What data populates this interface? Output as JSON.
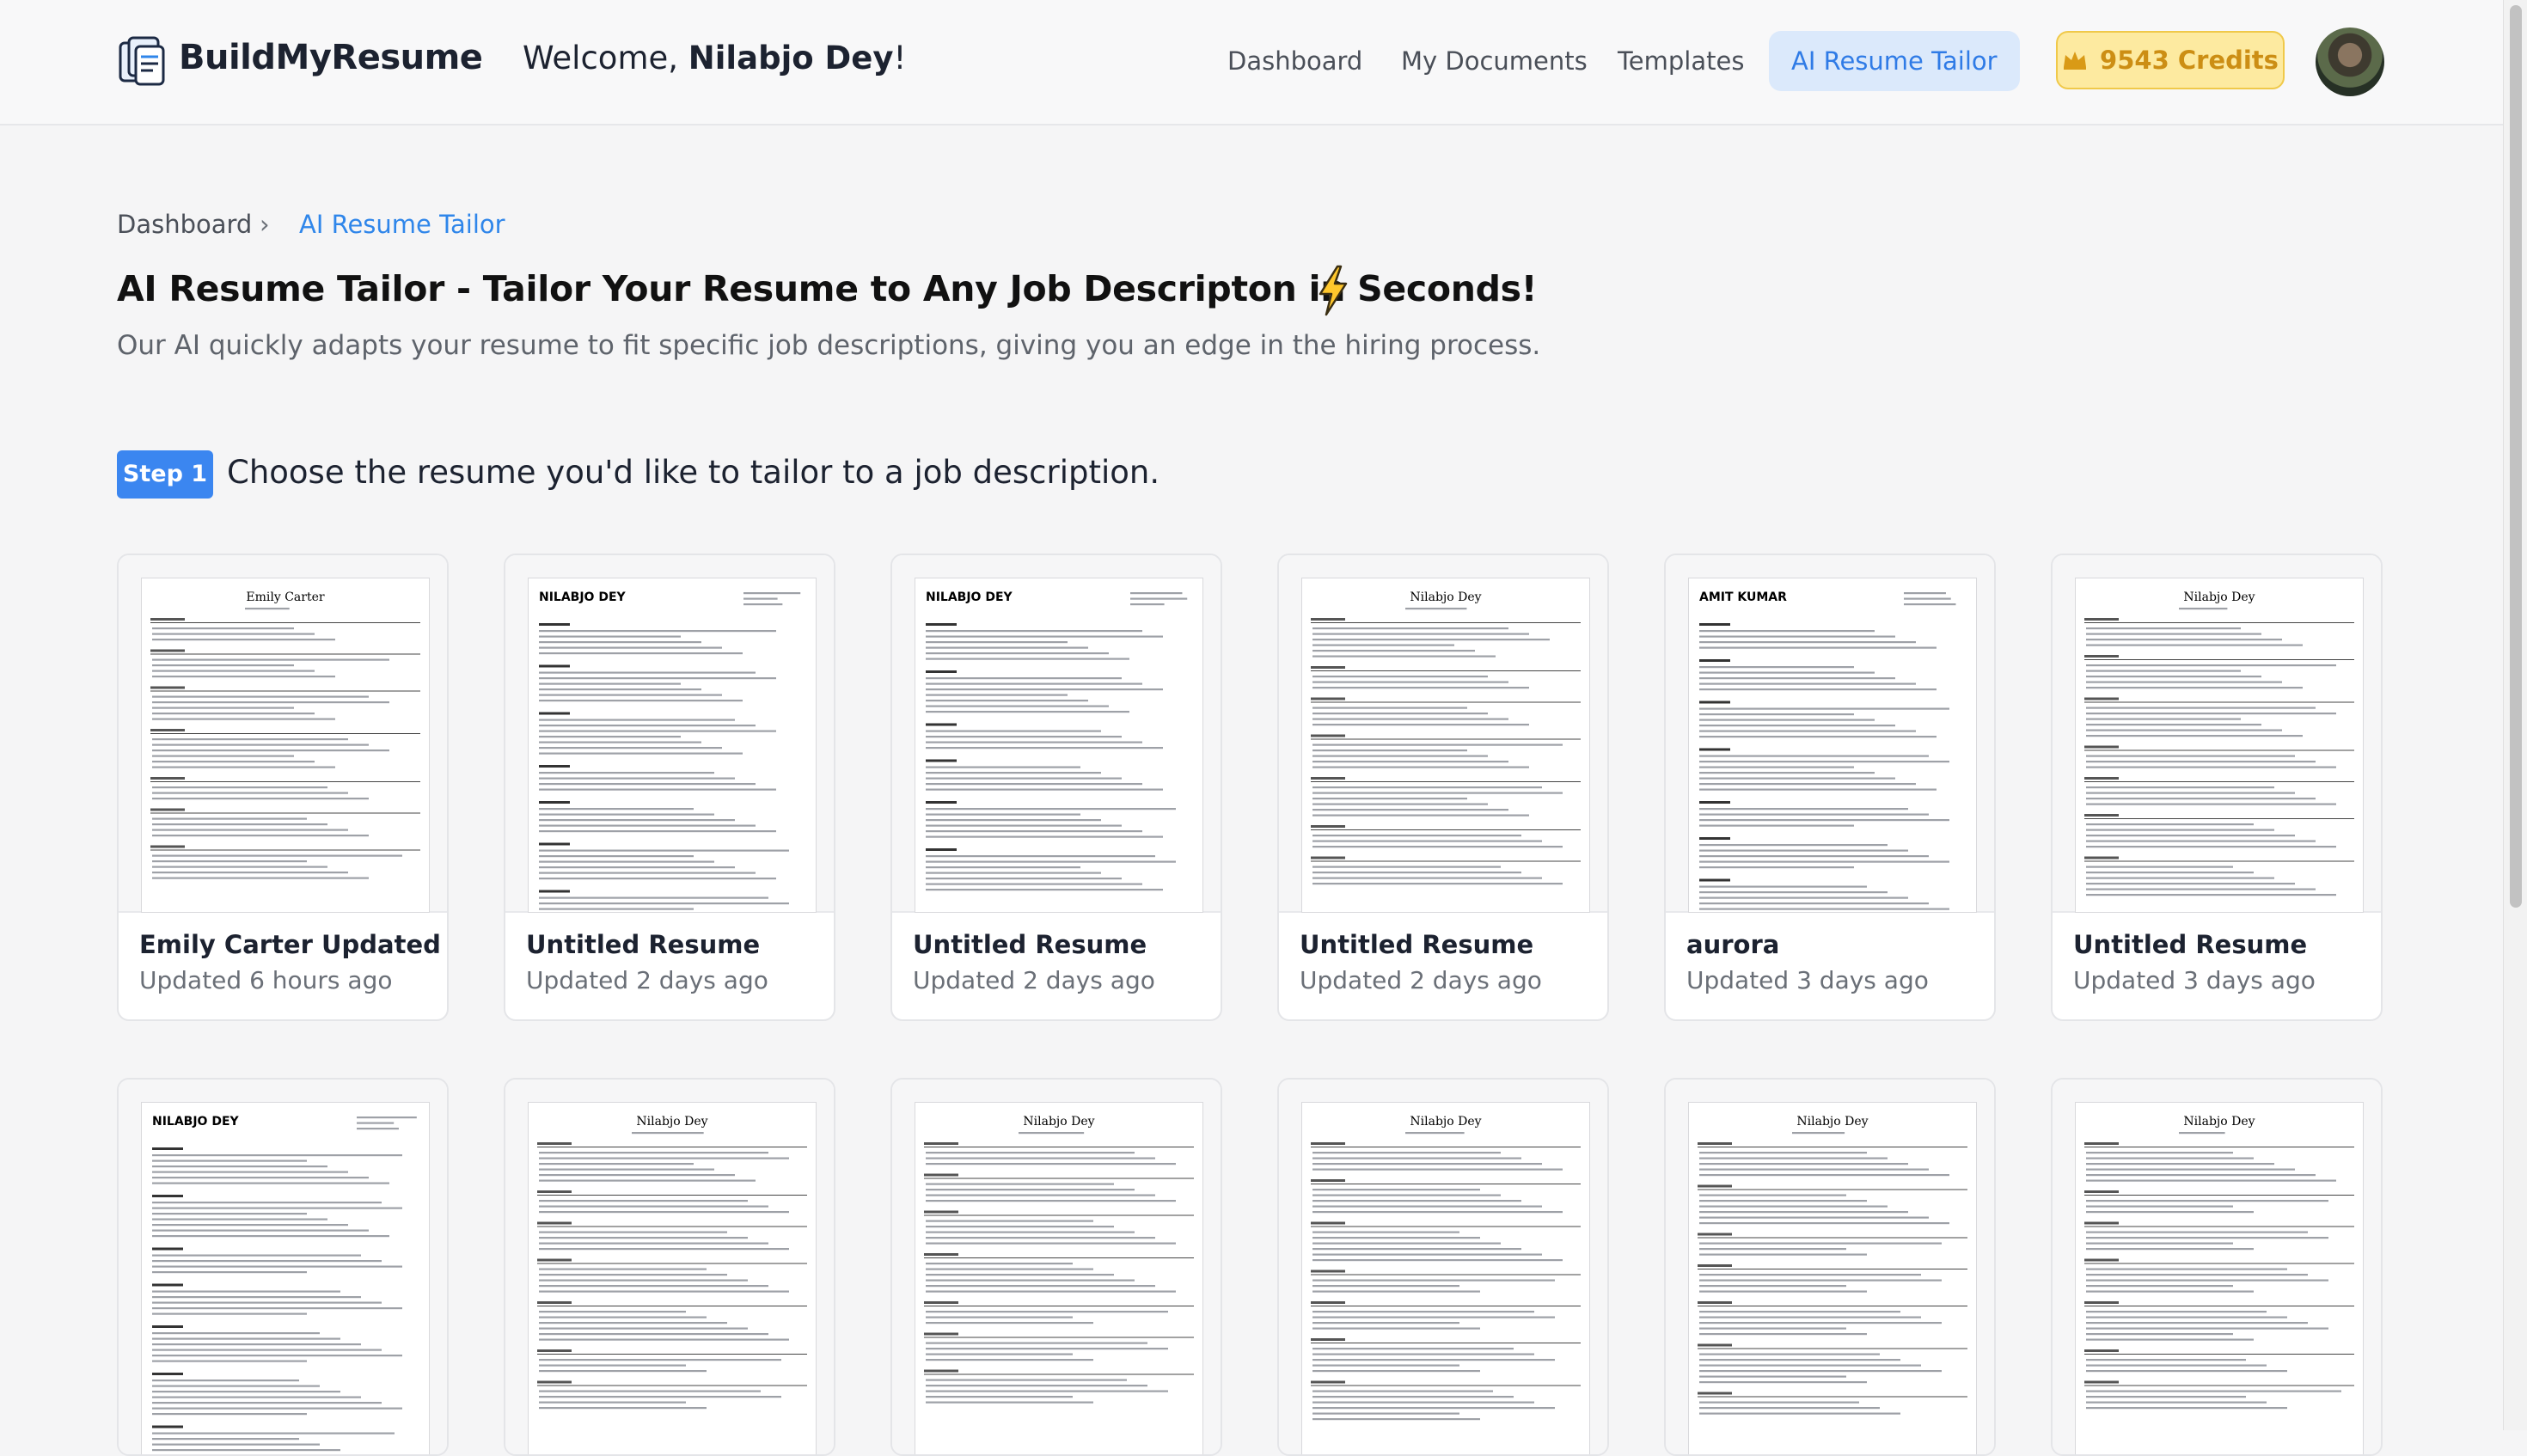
{
  "header": {
    "brand": "BuildMyResume",
    "welcome_prefix": "Welcome, ",
    "user_name": "Nilabjo Dey",
    "welcome_suffix": "!",
    "nav": [
      {
        "label": "Dashboard"
      },
      {
        "label": "My Documents"
      },
      {
        "label": "Templates"
      },
      {
        "label": "AI Resume Tailor",
        "active": true
      }
    ],
    "credits": "9543 Credits"
  },
  "breadcrumb": {
    "home": "Dashboard",
    "separator": "›",
    "current": "AI Resume Tailor"
  },
  "page": {
    "title": "AI Resume Tailor - Tailor Your Resume to Any Job Descripton in Seconds!",
    "subtitle": "Our AI quickly adapts your resume to fit specific job descriptions, giving you an edge in the hiring process."
  },
  "step": {
    "badge": "Step 1",
    "text": "Choose the resume you'd like to tailor to a job description."
  },
  "resumes": [
    {
      "title": "Emily Carter Updated",
      "updated": "Updated 6 hours ago",
      "preview_name": "Emily Carter",
      "style": "serif"
    },
    {
      "title": "Untitled Resume",
      "updated": "Updated 2 days ago",
      "preview_name": "NILABJO DEY",
      "style": "modern"
    },
    {
      "title": "Untitled Resume",
      "updated": "Updated 2 days ago",
      "preview_name": "NILABJO DEY",
      "style": "modern"
    },
    {
      "title": "Untitled Resume",
      "updated": "Updated 2 days ago",
      "preview_name": "Nilabjo Dey",
      "style": "serif"
    },
    {
      "title": "aurora",
      "updated": "Updated 3 days ago",
      "preview_name": "AMIT KUMAR",
      "style": "modern"
    },
    {
      "title": "Untitled Resume",
      "updated": "Updated 3 days ago",
      "preview_name": "Nilabjo Dey",
      "style": "serif"
    },
    {
      "preview_name": "NILABJO DEY",
      "style": "modern"
    },
    {
      "preview_name": "Nilabjo Dey",
      "style": "serif"
    },
    {
      "preview_name": "Nilabjo Dey",
      "style": "serif"
    },
    {
      "preview_name": "Nilabjo Dey",
      "style": "serif"
    },
    {
      "preview_name": "Nilabjo Dey",
      "style": "serif"
    },
    {
      "preview_name": "Nilabjo Dey",
      "style": "serif"
    }
  ],
  "colors": {
    "accent": "#2f86ea",
    "credits_bg": "#fdeaa0",
    "credits_text": "#cc8e14",
    "step_badge": "#3b86f0"
  },
  "icons": {
    "logo": "resume-stack-icon",
    "credits": "crown-icon",
    "title_emoji": "lightning-bolt-icon"
  }
}
